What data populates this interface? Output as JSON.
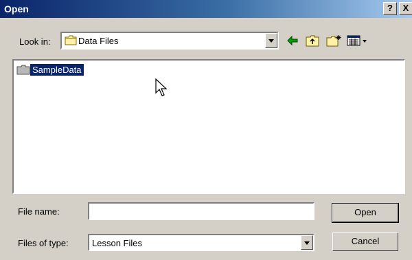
{
  "window": {
    "title": "Open",
    "help_label": "?",
    "close_label": "X"
  },
  "lookin": {
    "label": "Look in:",
    "value": "Data Files",
    "folder_icon": "folder-icon"
  },
  "toolbar": {
    "icons": [
      "back-arrow-icon",
      "up-folder-icon",
      "new-folder-icon",
      "view-menu-icon"
    ]
  },
  "filelist": {
    "items": [
      {
        "name": "SampleData",
        "icon": "folder-icon",
        "selected": true
      }
    ]
  },
  "filename": {
    "label": "File name:",
    "value": "",
    "placeholder": ""
  },
  "filetype": {
    "label": "Files of type:",
    "value": "Lesson Files"
  },
  "buttons": {
    "open": "Open",
    "cancel": "Cancel"
  },
  "colors": {
    "titlebar_start": "#0a246a",
    "titlebar_end": "#a6caf0",
    "face": "#d4d0c8",
    "selection": "#0a246a"
  }
}
